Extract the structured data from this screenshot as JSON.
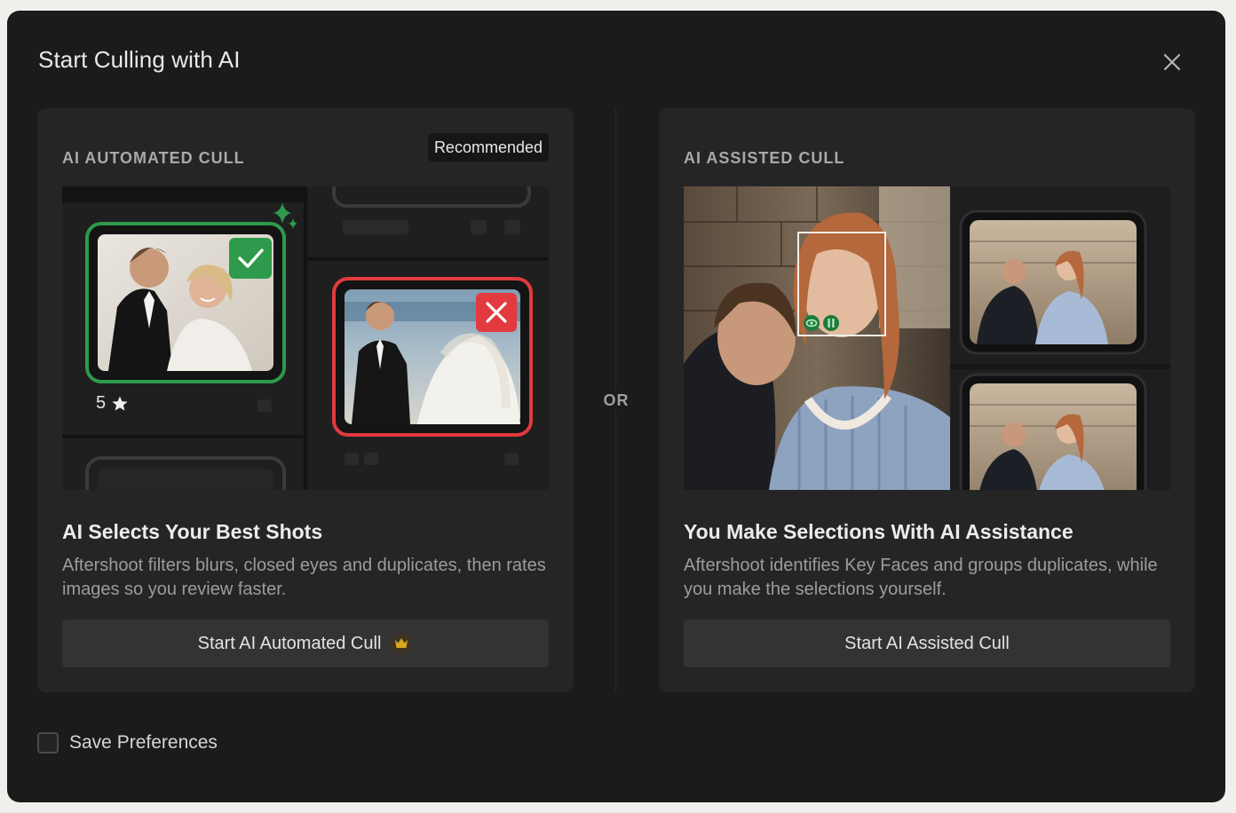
{
  "dialog": {
    "title": "Start Culling with AI",
    "close_icon": "close-icon"
  },
  "automated": {
    "label": "AI AUTOMATED CULL",
    "badge": "Recommended",
    "heading": "AI Selects Your Best Shots",
    "description": "Aftershoot filters blurs, closed eyes and duplicates, then rates images so you review faster.",
    "button_label": "Start AI Automated Cull",
    "button_icon": "crown-icon",
    "preview": {
      "rating_value": "5",
      "rating_icon": "star-icon",
      "selected_icon": "checkmark-icon",
      "rejected_icon": "x-icon",
      "sparkle_icon": "sparkle-icon",
      "accept_color": "#2e9a4b",
      "reject_color": "#e23a3f"
    }
  },
  "divider": {
    "label": "OR"
  },
  "assisted": {
    "label": "AI ASSISTED CULL",
    "heading": "You Make Selections With AI Assistance",
    "description": "Aftershoot identifies Key Faces and groups duplicates, while you make the selections yourself.",
    "button_label": "Start AI Assisted Cull",
    "preview": {
      "face_icons": [
        "eye-icon",
        "pause-icon"
      ]
    }
  },
  "footer": {
    "save_preferences_label": "Save Preferences",
    "save_preferences_checked": false
  },
  "colors": {
    "modal_bg": "#1b1b1c",
    "card_bg": "#252526",
    "button_bg": "#333334",
    "crown": "#d7a81e"
  }
}
